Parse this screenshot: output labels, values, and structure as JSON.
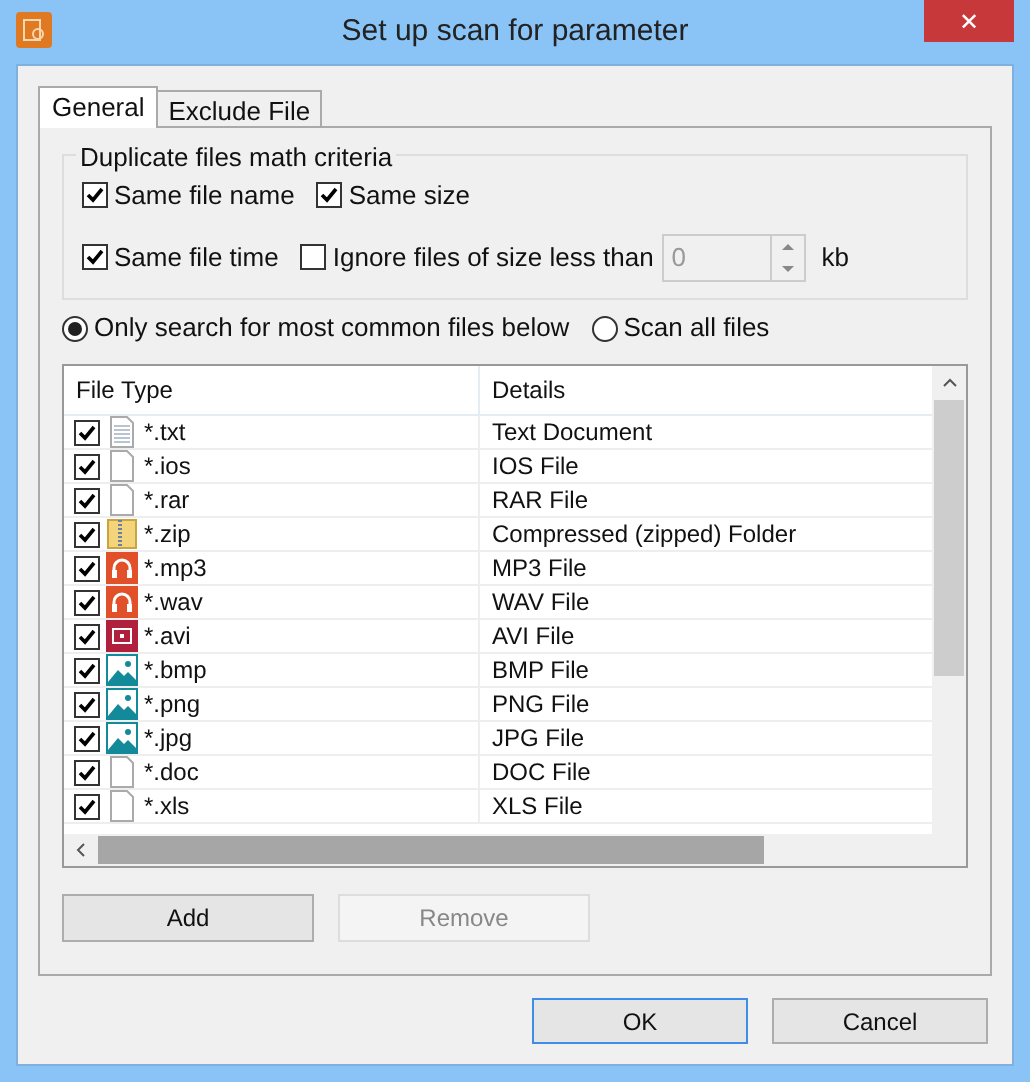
{
  "window": {
    "title": "Set up scan for parameter",
    "close": "✕"
  },
  "tabs": [
    {
      "label": "General",
      "selected": true
    },
    {
      "label": "Exclude File",
      "selected": false
    }
  ],
  "criteria": {
    "title": "Duplicate files math criteria",
    "options": [
      {
        "label": "Same file name",
        "checked": true
      },
      {
        "label": "Same size",
        "checked": true
      },
      {
        "label": "Same file time",
        "checked": true
      },
      {
        "label": "Ignore files of size less than",
        "checked": false
      }
    ],
    "size_value": "0",
    "unit": "kb",
    "size_disabled": true
  },
  "scope": [
    {
      "label": "Only search for most common files below",
      "selected": true
    },
    {
      "label": "Scan all files",
      "selected": false
    }
  ],
  "table": {
    "columns": [
      "File Type",
      "Details"
    ],
    "rows": [
      {
        "type": "*.txt",
        "details": "Text Document",
        "checked": true,
        "kind": "text"
      },
      {
        "type": "*.ios",
        "details": "IOS File",
        "checked": true,
        "kind": "blank"
      },
      {
        "type": "*.rar",
        "details": "RAR File",
        "checked": true,
        "kind": "blank"
      },
      {
        "type": "*.zip",
        "details": "Compressed (zipped) Folder",
        "checked": true,
        "kind": "zip"
      },
      {
        "type": "*.mp3",
        "details": "MP3 File",
        "checked": true,
        "kind": "audio"
      },
      {
        "type": "*.wav",
        "details": "WAV File",
        "checked": true,
        "kind": "audio"
      },
      {
        "type": "*.avi",
        "details": "AVI File",
        "checked": true,
        "kind": "video"
      },
      {
        "type": "*.bmp",
        "details": "BMP File",
        "checked": true,
        "kind": "image"
      },
      {
        "type": "*.png",
        "details": "PNG File",
        "checked": true,
        "kind": "image"
      },
      {
        "type": "*.jpg",
        "details": "JPG File",
        "checked": true,
        "kind": "image"
      },
      {
        "type": "*.doc",
        "details": "DOC File",
        "checked": true,
        "kind": "blank"
      },
      {
        "type": "*.xls",
        "details": "XLS File",
        "checked": true,
        "kind": "blank"
      }
    ]
  },
  "list_buttons": [
    {
      "label": "Add",
      "disabled": false
    },
    {
      "label": "Remove",
      "disabled": true
    }
  ],
  "dialog_buttons": [
    {
      "label": "OK",
      "default": true
    },
    {
      "label": "Cancel",
      "default": false
    }
  ]
}
